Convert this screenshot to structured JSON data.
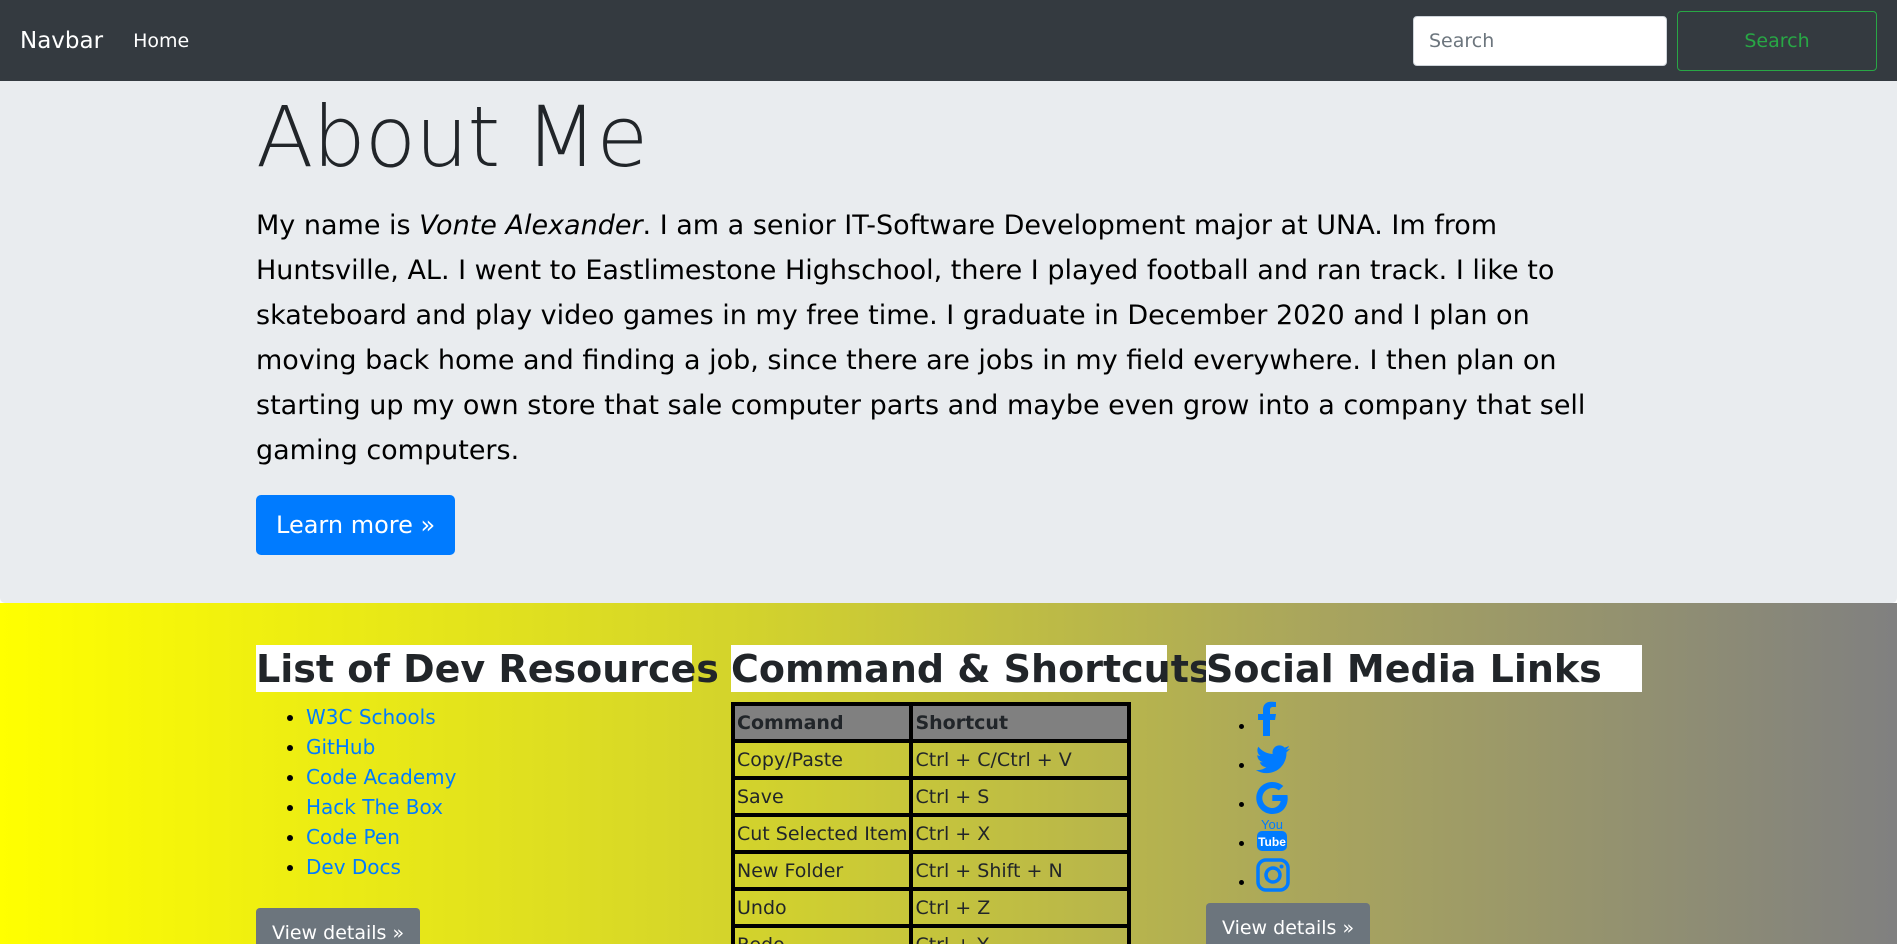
{
  "navbar": {
    "brand": "Navbar",
    "home": "Home",
    "search_placeholder": "Search",
    "search_button": "Search"
  },
  "about": {
    "title": "About Me",
    "lead_prefix": "My name is ",
    "name": "Vonte Alexander",
    "lead_suffix": ". I am a senior IT-Software Development major at UNA. Im from Huntsville, AL. I went to Eastlimestone Highschool, there I played football and ran track. I like to skateboard and play video games in my free time. I graduate in December 2020 and I plan on moving back home and finding a job, since there are jobs in my field everywhere. I then plan on starting up my own store that sale computer parts and maybe even grow into a company that sell gaming computers.",
    "button": "Learn more »"
  },
  "resources": {
    "title": "List of Dev Resources",
    "items": [
      "W3C Schools",
      "GitHub",
      "Code Academy",
      "Hack The Box",
      "Code Pen",
      "Dev Docs"
    ],
    "button": "View details »"
  },
  "commands": {
    "title": "Command & Shortcuts",
    "headers": [
      "Command",
      "Shortcut"
    ],
    "rows": [
      [
        "Copy/Paste",
        "Ctrl + C/Ctrl + V"
      ],
      [
        "Save",
        "Ctrl + S"
      ],
      [
        "Cut Selected Item",
        "Ctrl + X"
      ],
      [
        "New Folder",
        "Ctrl + Shift + N"
      ],
      [
        "Undo",
        "Ctrl + Z"
      ],
      [
        "Redo",
        "Ctrl + Y"
      ]
    ]
  },
  "social": {
    "title": "Social Media Links",
    "icons": [
      "facebook-icon",
      "twitter-icon",
      "google-icon",
      "youtube-icon",
      "instagram-icon"
    ],
    "button": "View details »"
  },
  "colors": {
    "navbar": "#343a40",
    "primary": "#007bff",
    "success": "#28a745",
    "secondary": "#6c757d",
    "jumbotron": "#e9ecef"
  }
}
